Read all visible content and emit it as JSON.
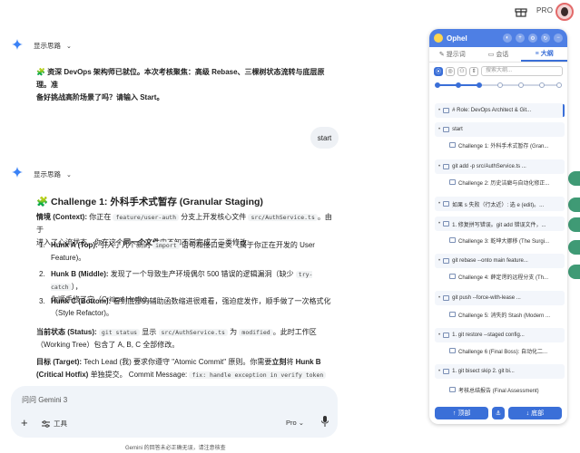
{
  "topbar": {
    "pro_label": "PRO"
  },
  "chat": {
    "show_thoughts_label": "显示思路",
    "intro_line1": "🧩 资深 DevOps 架构师已就位。本次考核聚焦：高级 Rebase、三棵树状态流转与底层原理。准",
    "intro_line2": "备好挑战高阶场景了吗？请输入 Start。",
    "user_message": "start",
    "challenge_title": "🧩 Challenge 1: 外科手术式暂存 (Granular Staging)",
    "context_label": "情境 (Context):",
    "context_text_a": " 你正在 ",
    "context_branch": "feature/user-auth",
    "context_text_b": " 分支上开发核心文件 ",
    "context_file": "src/AuthService.ts",
    "context_text_c": "。由于",
    "context_line2a": "进入了心流状态，你在这个",
    "context_line2b": "同一个文件",
    "context_line2c": "中不知不觉完成了三类修改:",
    "hunks": [
      {
        "num": "1.",
        "label": "Hunk A (Top):",
        "line1a": " 引入了几个新的 ",
        "code": "import",
        "line1b": " 语句和接口定义（属于你正在开发的 User",
        "line2": "Feature)。"
      },
      {
        "num": "2.",
        "label": "Hunk B (Middle):",
        "line1a": " 发现了一个导致生产环境偶尔 500 错误的逻辑漏洞（缺少 ",
        "code": "try-catch",
        "line1b": "），",
        "line2": "你顺手修了它（Critical Hotfix)。"
      },
      {
        "num": "3.",
        "label": "Hunk C (Bottom):",
        "line1a": " 看到底部的辅助函数缩进很难看，强迫症发作，顺手做了一次格式化",
        "code": "",
        "line1b": "",
        "line2": "（Style Refactor)。"
      }
    ],
    "status_label": "当前状态 (Status):",
    "status_code1": "git status",
    "status_text_a": " 显示 ",
    "status_code2": "src/AuthService.ts",
    "status_text_b": " 为 ",
    "status_code3": "modified",
    "status_text_c": "。此时工作区",
    "status_line2": "（Working Tree）包含了 A, B, C 全部修改。",
    "target_label": "目标 (Target):",
    "target_text_a": " Tech Lead (我) 要求你遵守 \"Atomic Commit\" 原则。你需要",
    "target_bold": "立刻",
    "target_text_b": "将 ",
    "target_bold2": "Hunk B",
    "target_line2a": "(Critical Hotfix)",
    "target_line2b": " 单独提交。 Commit Message: ",
    "target_code": "fix: handle exception in verify token"
  },
  "input": {
    "placeholder": "问问 Gemini 3",
    "tools_label": "工具",
    "mode_label": "Pro",
    "disclaimer": "Gemini 的回答未必正确无误，请注意核查"
  },
  "panel": {
    "title": "Ophel",
    "tabs": [
      {
        "label": "提示词",
        "icon": "✎"
      },
      {
        "label": "会话",
        "icon": "▭"
      },
      {
        "label": "大纲",
        "icon": "≡"
      }
    ],
    "search_placeholder": "搜索大纲...",
    "slider_level": 0.5,
    "outline": [
      {
        "level": 1,
        "text": "# Role: DevOps Architect & Git...",
        "bar": true
      },
      {
        "level": 1,
        "text": "start",
        "bar": false
      },
      {
        "level": 2,
        "text": "Challenge 1: 外科手术式暂存 (Gran..."
      },
      {
        "level": 1,
        "text": "git add -p src/AuthService.ts ...",
        "bar": false
      },
      {
        "level": 2,
        "text": "Challenge 2: 历史洁癖与自动化修正..."
      },
      {
        "level": 1,
        "text": "如果 s 失败（行太近）: 选 e (edit)。...",
        "bar": false
      },
      {
        "level": 1,
        "text": "1. 修复拼写错误。git add 错误文件，...",
        "bar": false
      },
      {
        "level": 2,
        "text": "Challenge 3: 乾坤大挪移 (The Surgi..."
      },
      {
        "level": 1,
        "text": "git rebase --onto main feature...",
        "bar": false
      },
      {
        "level": 2,
        "text": "Challenge 4: 薛定谔的远程分支 (Th..."
      },
      {
        "level": 1,
        "text": "git push --force-with-lease ...",
        "bar": false
      },
      {
        "level": 2,
        "text": "Challenge 5: 消失的 Stash (Modern ..."
      },
      {
        "level": 1,
        "text": "1. git restore --staged config...",
        "bar": false
      },
      {
        "level": 2,
        "text": "Challenge 6 (Final Boss): 自动化二..."
      },
      {
        "level": 1,
        "text": "1. git bisect skip 2. git bi...",
        "bar": false
      },
      {
        "level": 2,
        "text": "考核总结报告 (Final Assessment)"
      }
    ],
    "top_button": "顶部",
    "bottom_button": "底部"
  }
}
